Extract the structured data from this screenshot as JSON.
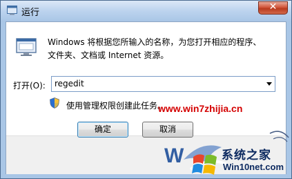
{
  "window": {
    "title": "运行",
    "close_glyph": "✕"
  },
  "icons": {
    "run": "run-dialog-icon",
    "shield": "uac-shield-icon",
    "title": "run-title-icon",
    "logo": "windows-logo-icon"
  },
  "description": {
    "line1": "Windows 将根据您所输入的名称，为您打开相应的程序、",
    "line2": "文件夹、文档或 Internet 资源。"
  },
  "open": {
    "label": "打开(O):",
    "value": "regedit"
  },
  "admin_note": "使用管理权限创建此任务。",
  "buttons": {
    "ok": "确定",
    "cancel": "取消"
  },
  "watermark": {
    "url": "www.win7zhijia.cn",
    "brand": "系统之家",
    "brand_url": "Win10net.com"
  },
  "colors": {
    "frame": "#a9c6e6",
    "close": "#c9452a",
    "watermark_red": "#d40000",
    "brand_navy": "#0d2a60"
  }
}
